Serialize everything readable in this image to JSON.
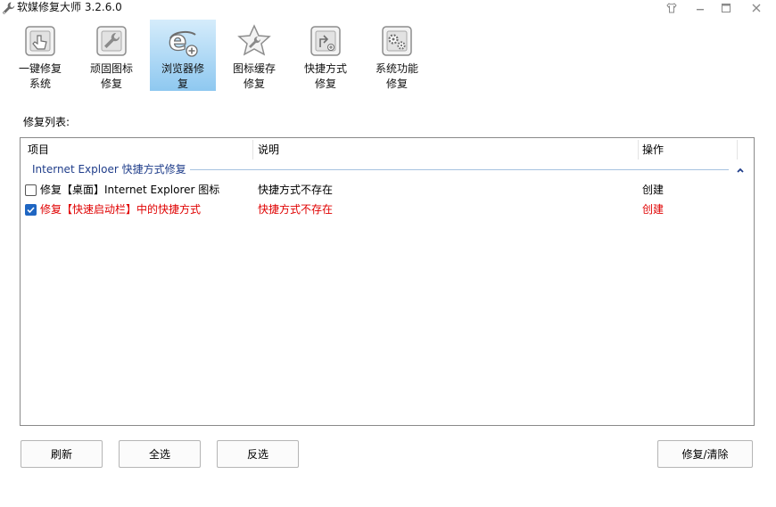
{
  "window": {
    "title": "软媒修复大师 3.2.6.0",
    "app_icon": "wrench-icon",
    "controls": [
      "skin-icon",
      "minimize-icon",
      "maximize-icon",
      "close-icon"
    ]
  },
  "toolbar": {
    "items": [
      {
        "label": "一键修复\n系统",
        "icon": "one-click-repair-icon",
        "active": false
      },
      {
        "label": "顽固图标\n修复",
        "icon": "stubborn-icon-repair-icon",
        "active": false
      },
      {
        "label": "浏览器修\n复",
        "icon": "browser-repair-icon",
        "active": true
      },
      {
        "label": "图标缓存\n修复",
        "icon": "icon-cache-repair-icon",
        "active": false
      },
      {
        "label": "快捷方式\n修复",
        "icon": "shortcut-repair-icon",
        "active": false
      },
      {
        "label": "系统功能\n修复",
        "icon": "system-function-repair-icon",
        "active": false
      }
    ]
  },
  "list": {
    "caption": "修复列表:",
    "columns": [
      "项目",
      "说明",
      "操作"
    ],
    "group": {
      "label": "Internet Exploer 快捷方式修复",
      "toggle_icon": "chevron-up-icon"
    },
    "rows": [
      {
        "item": "修复【桌面】Internet Explorer 图标",
        "desc": "快捷方式不存在",
        "action": "创建",
        "checked": false,
        "color": "#000000"
      },
      {
        "item": "修复【快速启动栏】中的快捷方式",
        "desc": "快捷方式不存在",
        "action": "创建",
        "checked": true,
        "color": "#e00000"
      }
    ]
  },
  "buttons": {
    "refresh": "刷新",
    "select_all": "全选",
    "invert": "反选",
    "repair": "修复/清除"
  },
  "colors": {
    "accent": "#1f66c2",
    "active_tab": "#8ec8f0",
    "group_text": "#1f3d8a",
    "warning_text": "#e00000"
  }
}
